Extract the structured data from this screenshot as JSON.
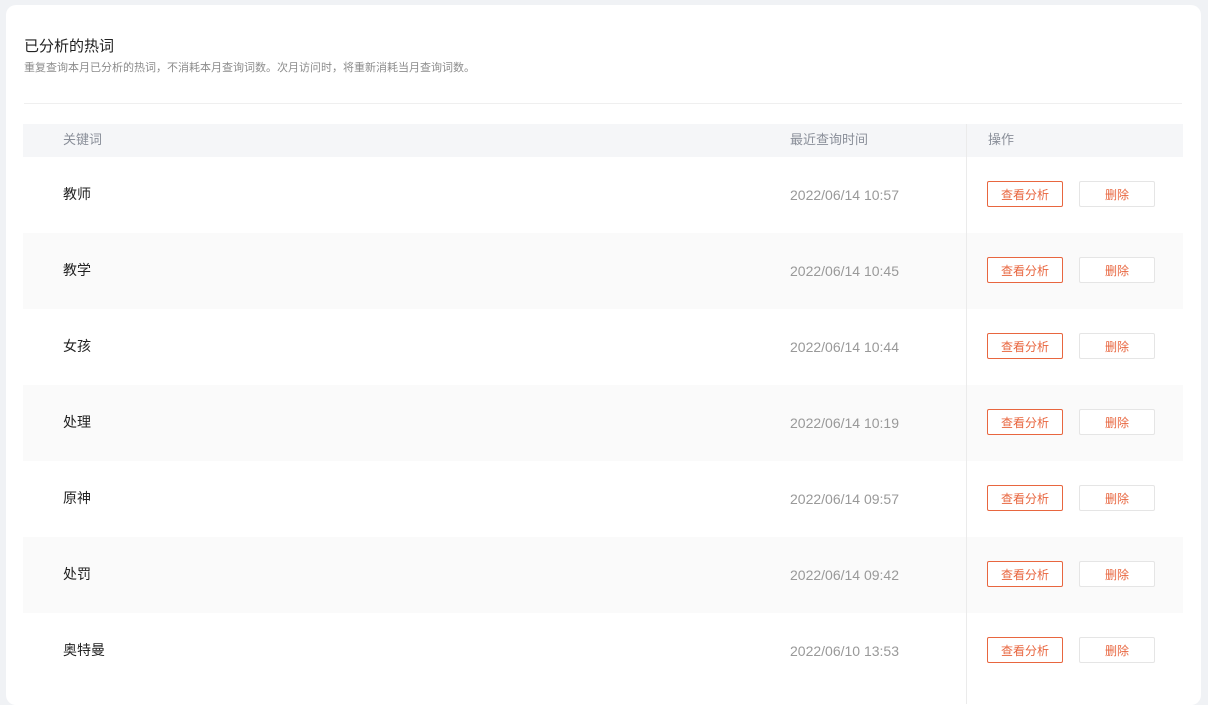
{
  "header": {
    "title": "已分析的热词",
    "subtitle": "重复查询本月已分析的热词，不消耗本月查询词数。次月访问时，将重新消耗当月查询词数。"
  },
  "table": {
    "columns": {
      "keyword": "关键词",
      "time": "最近查询时间",
      "actions": "操作"
    },
    "rows": [
      {
        "keyword": "教师",
        "time": "2022/06/14 10:57",
        "view_label": "查看分析",
        "delete_label": "删除"
      },
      {
        "keyword": "教学",
        "time": "2022/06/14 10:45",
        "view_label": "查看分析",
        "delete_label": "删除"
      },
      {
        "keyword": "女孩",
        "time": "2022/06/14 10:44",
        "view_label": "查看分析",
        "delete_label": "删除"
      },
      {
        "keyword": "处理",
        "time": "2022/06/14 10:19",
        "view_label": "查看分析",
        "delete_label": "删除"
      },
      {
        "keyword": "原神",
        "time": "2022/06/14 09:57",
        "view_label": "查看分析",
        "delete_label": "删除"
      },
      {
        "keyword": "处罚",
        "time": "2022/06/14 09:42",
        "view_label": "查看分析",
        "delete_label": "删除"
      },
      {
        "keyword": "奥特曼",
        "time": "2022/06/10 13:53",
        "view_label": "查看分析",
        "delete_label": "删除"
      }
    ]
  },
  "colors": {
    "accent": "#e8663f",
    "header_bg": "#f5f6f8",
    "row_alt_bg": "#fafafa"
  }
}
